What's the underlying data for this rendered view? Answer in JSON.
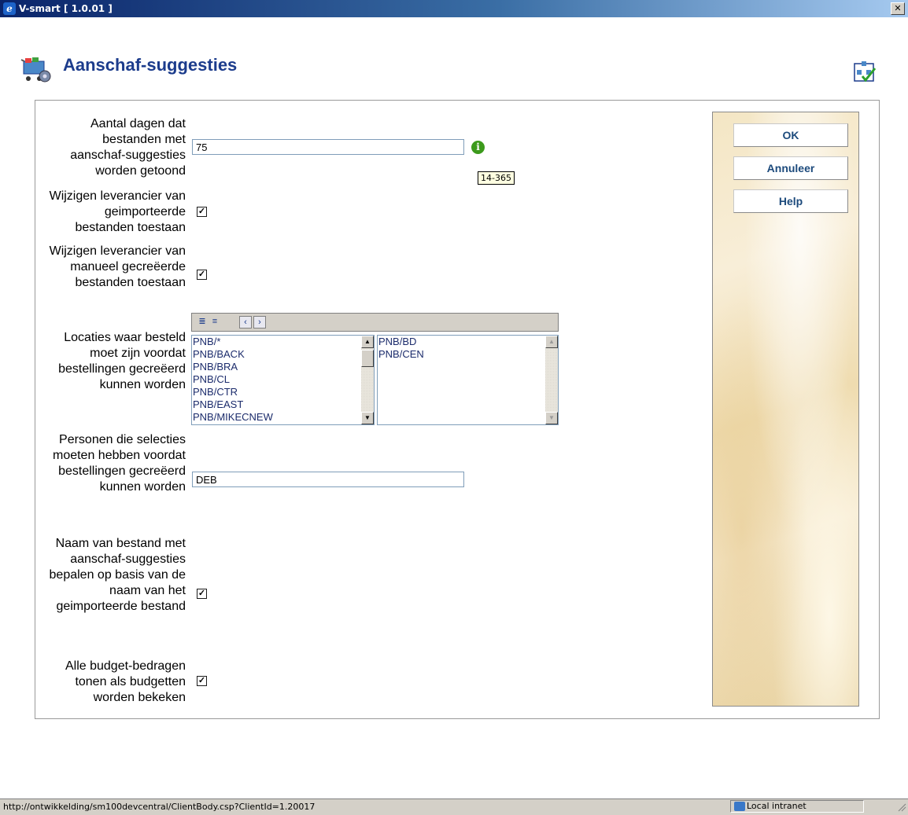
{
  "window": {
    "title": "V-smart [ 1.0.01 ]"
  },
  "header": {
    "title": "Aanschaf-suggesties"
  },
  "fields": {
    "days": {
      "label": "Aantal dagen dat bestanden met aanschaf-suggesties worden getoond",
      "value": "75",
      "tooltip": "14-365"
    },
    "change_supplier_imported": {
      "label": "Wijzigen leverancier van geimporteerde bestanden toestaan",
      "checked": true
    },
    "change_supplier_manual": {
      "label": "Wijzigen leverancier van manueel gecreëerde bestanden toestaan",
      "checked": true
    },
    "locations": {
      "label": "Locaties waar besteld moet zijn voordat bestellingen gecreëerd kunnen worden",
      "available": [
        "PNB/*",
        "PNB/BACK",
        "PNB/BRA",
        "PNB/CL",
        "PNB/CTR",
        "PNB/EAST",
        "PNB/MIKECNEW"
      ],
      "selected": [
        "PNB/BD",
        "PNB/CEN"
      ]
    },
    "persons": {
      "label": "Personen die selecties moeten hebben voordat bestellingen gecreëerd kunnen worden",
      "value": "DEB"
    },
    "filename_from_import": {
      "label": "Naam van bestand met aanschaf-suggesties bepalen op basis van de naam van het geimporteerde bestand",
      "checked": true
    },
    "show_budget_amounts": {
      "label": "Alle budget-bedragen tonen als budgetten worden bekeken",
      "checked": true
    }
  },
  "buttons": {
    "ok": "OK",
    "cancel": "Annuleer",
    "help": "Help"
  },
  "status": {
    "url": "http://ontwikkelding/sm100devcentral/ClientBody.csp?ClientId=1.20017",
    "zone": "Local intranet"
  }
}
